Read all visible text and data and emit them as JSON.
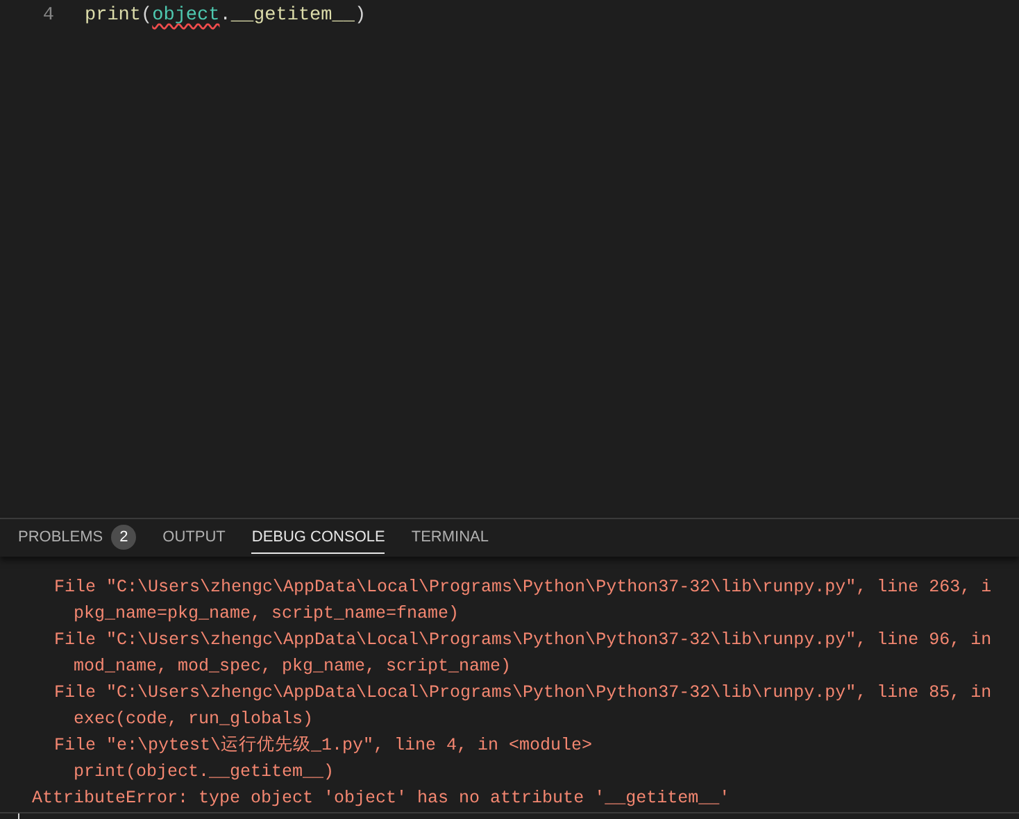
{
  "editor": {
    "lines": [
      {
        "number": "4",
        "tokens": [
          {
            "text": "print",
            "kind": "function",
            "error": false
          },
          {
            "text": "(",
            "kind": "punct",
            "error": false
          },
          {
            "text": "object",
            "kind": "type",
            "error": true
          },
          {
            "text": ".",
            "kind": "punct",
            "error": false
          },
          {
            "text": "__getitem__",
            "kind": "function",
            "error": false
          },
          {
            "text": ")",
            "kind": "punct",
            "error": false
          }
        ]
      }
    ]
  },
  "panel": {
    "tabs": [
      {
        "label": "PROBLEMS",
        "badge": "2",
        "selected": false
      },
      {
        "label": "OUTPUT",
        "selected": false
      },
      {
        "label": "DEBUG CONSOLE",
        "selected": true
      },
      {
        "label": "TERMINAL",
        "selected": false
      }
    ],
    "console": [
      {
        "kind": "frame",
        "text": "File \"C:\\Users\\zhengc\\AppData\\Local\\Programs\\Python\\Python37-32\\lib\\runpy.py\", line 263, i"
      },
      {
        "kind": "source",
        "text": "pkg_name=pkg_name, script_name=fname)"
      },
      {
        "kind": "frame",
        "text": "File \"C:\\Users\\zhengc\\AppData\\Local\\Programs\\Python\\Python37-32\\lib\\runpy.py\", line 96, in"
      },
      {
        "kind": "source",
        "text": "mod_name, mod_spec, pkg_name, script_name)"
      },
      {
        "kind": "frame",
        "text": "File \"C:\\Users\\zhengc\\AppData\\Local\\Programs\\Python\\Python37-32\\lib\\runpy.py\", line 85, in"
      },
      {
        "kind": "source",
        "text": "exec(code, run_globals)"
      },
      {
        "kind": "frame",
        "text": "File \"e:\\pytest\\运行优先级_1.py\", line 4, in <module>"
      },
      {
        "kind": "source",
        "text": "print(object.__getitem__)"
      },
      {
        "kind": "error",
        "text": "AttributeError: type object 'object' has no attribute '__getitem__'"
      }
    ]
  }
}
